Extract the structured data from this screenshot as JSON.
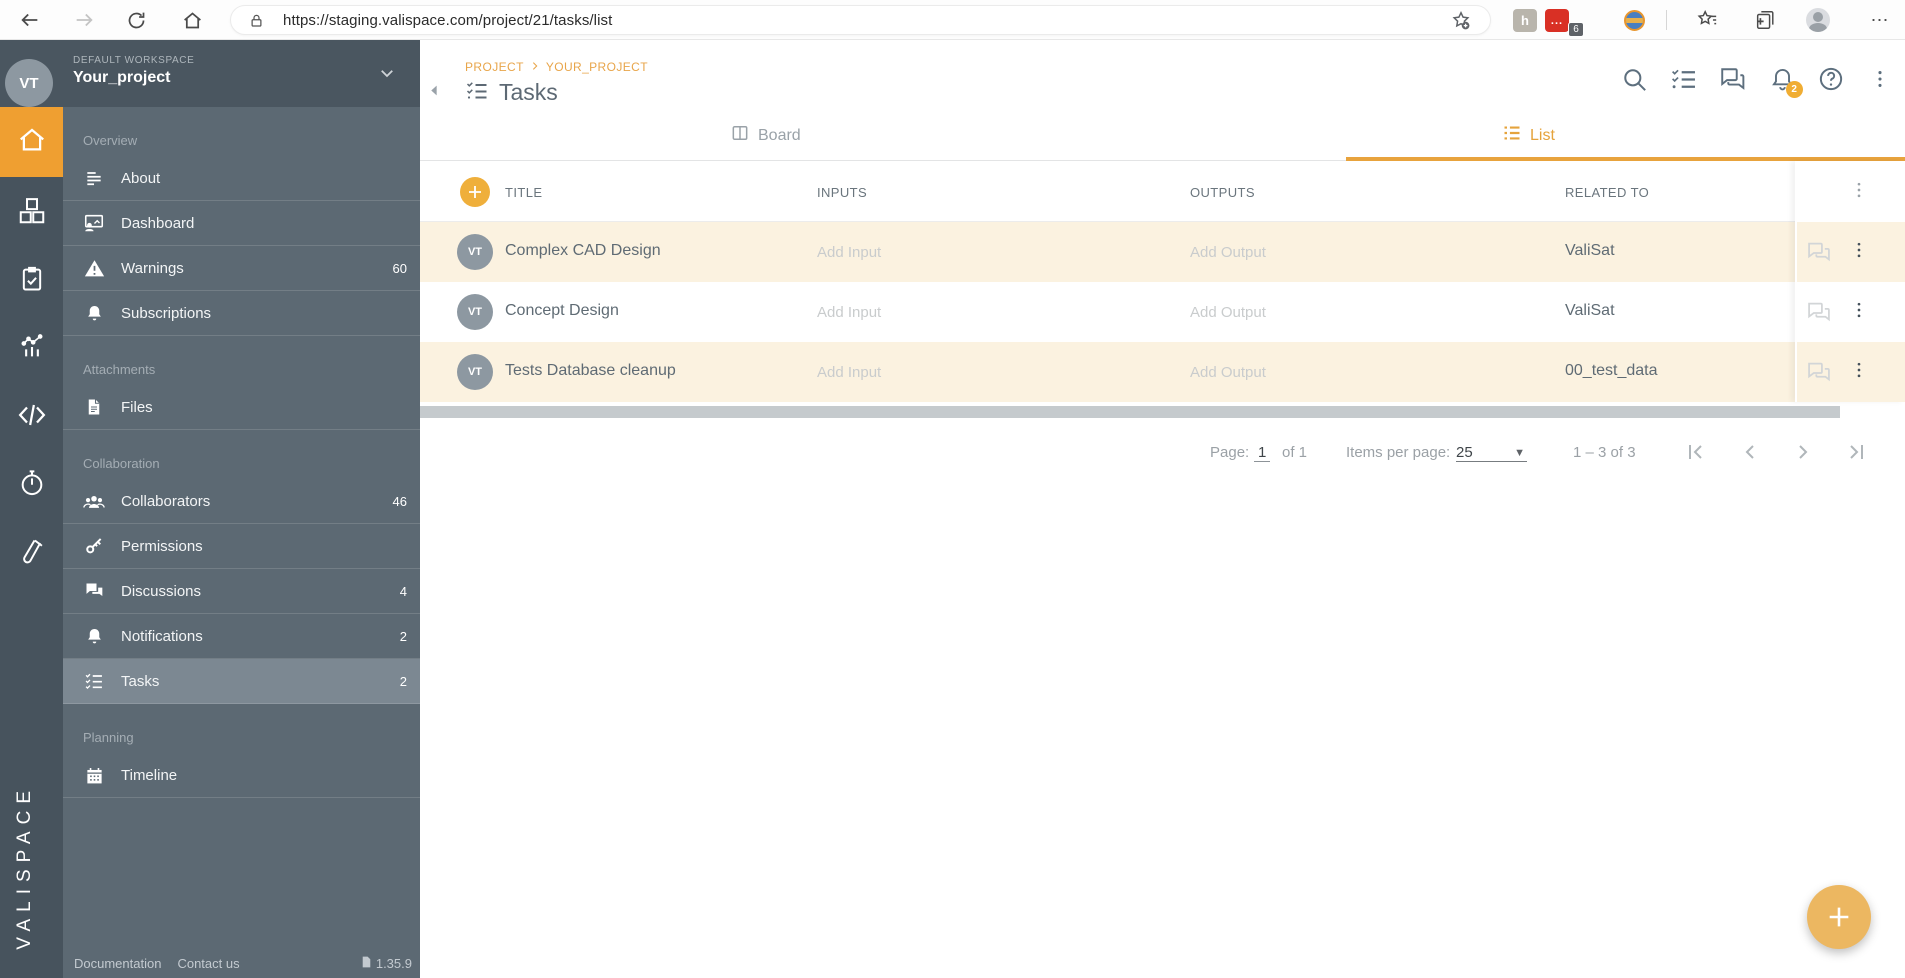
{
  "browser": {
    "url": "https://staging.valispace.com/project/21/tasks/list",
    "extension_h_label": "h",
    "extension_dots_label": "...",
    "extension_badge": "6"
  },
  "workspace": {
    "label": "DEFAULT WORKSPACE",
    "name": "Your_project",
    "avatar_initials": "VT"
  },
  "sidebar": {
    "sections": [
      {
        "label": "Overview",
        "items": [
          {
            "label": "About"
          },
          {
            "label": "Dashboard"
          },
          {
            "label": "Warnings",
            "badge": "60"
          },
          {
            "label": "Subscriptions"
          }
        ]
      },
      {
        "label": "Attachments",
        "items": [
          {
            "label": "Files"
          }
        ]
      },
      {
        "label": "Collaboration",
        "items": [
          {
            "label": "Collaborators",
            "badge": "46"
          },
          {
            "label": "Permissions"
          },
          {
            "label": "Discussions",
            "badge": "4"
          },
          {
            "label": "Notifications",
            "badge": "2"
          },
          {
            "label": "Tasks",
            "badge": "2"
          }
        ]
      },
      {
        "label": "Planning",
        "items": [
          {
            "label": "Timeline"
          }
        ]
      }
    ],
    "footer": {
      "documentation": "Documentation",
      "contact": "Contact us",
      "version": "1.35.9"
    },
    "logo_vertical": "VALISPACE"
  },
  "main": {
    "breadcrumb": {
      "root": "PROJECT",
      "current": "YOUR_PROJECT"
    },
    "title": "Tasks",
    "header_notifications_badge": "2",
    "tabs": {
      "board": "Board",
      "list": "List"
    },
    "table": {
      "columns": {
        "title": "TITLE",
        "inputs": "INPUTS",
        "outputs": "OUTPUTS",
        "related": "RELATED TO"
      },
      "rows": [
        {
          "avatar": "VT",
          "title": "Complex CAD Design",
          "input": "Add Input",
          "output": "Add Output",
          "related": "ValiSat"
        },
        {
          "avatar": "VT",
          "title": "Concept Design",
          "input": "Add Input",
          "output": "Add Output",
          "related": "ValiSat"
        },
        {
          "avatar": "VT",
          "title": "Tests Database cleanup",
          "input": "Add Input",
          "output": "Add Output",
          "related": "00_test_data"
        }
      ]
    },
    "pagination": {
      "page_label": "Page:",
      "page_value": "1",
      "page_of": "of 1",
      "items_label": "Items per page:",
      "items_value": "25",
      "range": "1 – 3 of 3"
    }
  },
  "colors": {
    "accent_orange": "#E8A33D",
    "sidebar_bg": "#5C6973",
    "rail_bg": "#47535D",
    "selected_item_bg": "#7C8892",
    "row_highlight": "#FBF2E0",
    "badge_orange": "#F0AD33"
  }
}
